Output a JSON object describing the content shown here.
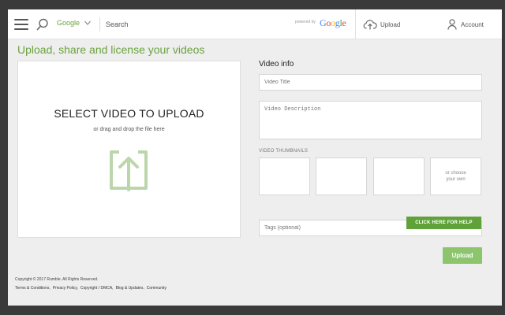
{
  "header": {
    "search_engine": "Google",
    "search_placeholder": "Search",
    "powered_by": "powered by",
    "google_logo_letters": [
      "G",
      "o",
      "o",
      "g",
      "l",
      "e"
    ],
    "google_logo_colors": [
      "#4285f4",
      "#ea4335",
      "#fbbc05",
      "#4285f4",
      "#34a853",
      "#ea4335"
    ],
    "upload_label": "Upload",
    "account_label": "Account"
  },
  "page_title": "Upload, share and license your videos",
  "dropzone": {
    "title": "SELECT VIDEO TO UPLOAD",
    "subtitle": "or drag and drop the file here"
  },
  "form": {
    "section_title": "Video info",
    "title_placeholder": "Video Title",
    "description_placeholder": "Video Description",
    "thumbnails_label": "VIDEO THUMBNAILS",
    "choose_own_label": "or choose your own",
    "tags_placeholder": "Tags (optional)",
    "help_button": "CLICK HERE FOR HELP",
    "upload_button": "Upload"
  },
  "footer": {
    "copyright": "Copyright © 2017 Rumble. All Rights Reserved.",
    "links": [
      "Terms & Conditions,",
      "Privacy Policy,",
      "Copyright / DMCA,",
      "Blog & Updates,",
      "Community"
    ]
  },
  "colors": {
    "accent_green": "#6aa33f",
    "help_button_bg": "#5fa23a",
    "upload_button_bg": "#8cc56b",
    "upload_icon": "#bcd6ab"
  },
  "icons": [
    "menu-icon",
    "search-icon",
    "chevron-down-icon",
    "cloud-upload-icon",
    "user-icon",
    "upload-arrow-icon"
  ]
}
